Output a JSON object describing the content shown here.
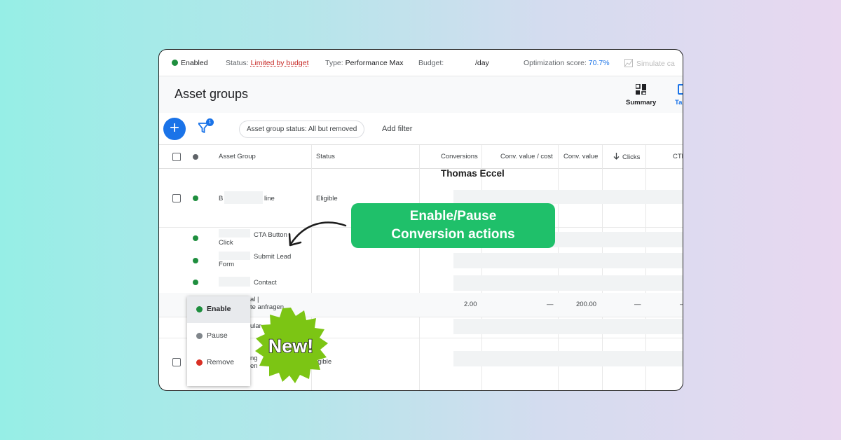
{
  "statusbar": {
    "enabled": "Enabled",
    "status_label": "Status:",
    "status_value": "Limited by budget",
    "type_label": "Type:",
    "type_value": "Performance Max",
    "budget_label": "Budget:",
    "budget_value": "/day",
    "opt_label": "Optimization score:",
    "opt_value": "70.7%",
    "simulate": "Simulate ca"
  },
  "header": {
    "title": "Asset groups",
    "summary": "Summary",
    "table_tab": "Ta"
  },
  "filters": {
    "add": "+",
    "filter_count": "1",
    "chip": "Asset group status: All but removed",
    "add_filter": "Add filter"
  },
  "table": {
    "columns": [
      "Asset Group",
      "Status",
      "Conversions",
      "Conv. value / cost",
      "Conv. value",
      "Clicks",
      "CTR"
    ],
    "row1": {
      "name_start": "B",
      "name_end": "line",
      "status": "Eligible"
    },
    "sub_rows": [
      {
        "line1": "CTA Button",
        "line2": "Click"
      },
      {
        "line1": "Submit Lead",
        "line2": "Form"
      },
      {
        "line1": "Contact",
        "line2": ""
      }
    ],
    "highlight_row": {
      "line1": "al |",
      "line2": "te anfragen",
      "conversions": "2.00",
      "conv_value_cost": "—",
      "conv_value": "200.00",
      "clicks": "—",
      "ctr": "–"
    },
    "row_partial": {
      "text": "ular"
    },
    "row3": {
      "line1": "ng",
      "line2": "en",
      "status": "igible"
    }
  },
  "menu": {
    "items": [
      "Enable",
      "Pause",
      "Remove"
    ]
  },
  "overlay": {
    "author": "Thomas Eccel",
    "callout_line1": "Enable/Pause",
    "callout_line2": "Conversion actions",
    "new_badge": "New!"
  },
  "colors": {
    "callout": "#1fc06a",
    "badge": "#7cc514",
    "accent": "#1a73e8",
    "enabled": "#1e8e3e"
  }
}
